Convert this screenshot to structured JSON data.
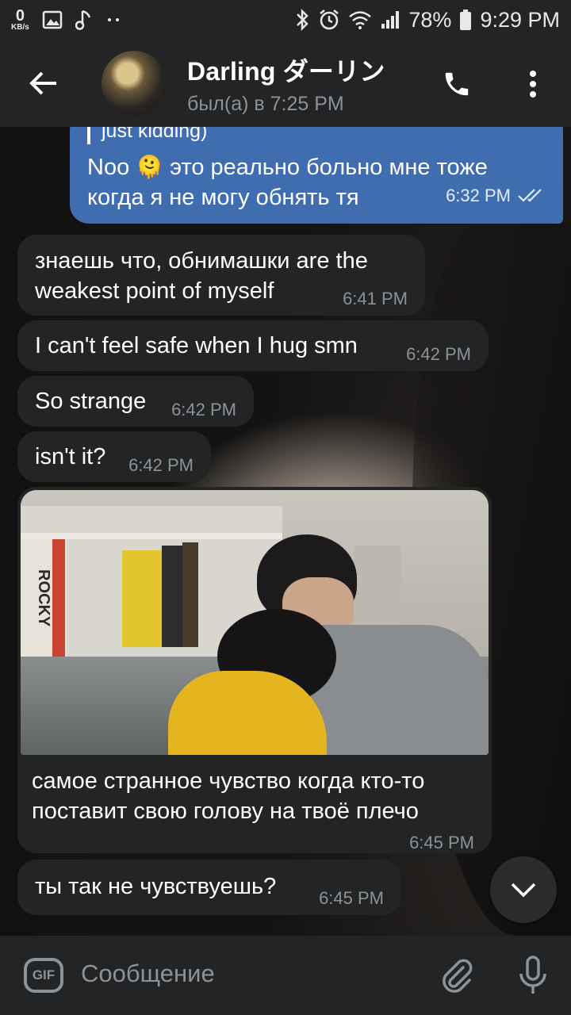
{
  "status_bar": {
    "net_speed": "0",
    "net_unit": "KB/s",
    "battery": "78%",
    "time": "9:29 PM"
  },
  "header": {
    "title": "Darling ダーリン",
    "subtitle": "был(а) в 7:25 PM"
  },
  "messages": [
    {
      "direction": "out",
      "reply_quote": "just kidding)",
      "text_before_emoji": "Noo",
      "emoji": "🫠",
      "text_after_emoji": "это реально больно мне тоже",
      "text_line2": "когда я не могу обнять тя",
      "time": "6:32 PM"
    },
    {
      "direction": "in",
      "line1": "знаешь что, обнимашки are the",
      "line2": "weakest point of myself",
      "time": "6:41 PM"
    },
    {
      "direction": "in",
      "text": "I can't feel safe when I hug smn",
      "time": "6:42 PM"
    },
    {
      "direction": "in",
      "text": "So strange",
      "time": "6:42 PM"
    },
    {
      "direction": "in",
      "text": "isn't it?",
      "time": "6:42 PM"
    },
    {
      "direction": "in",
      "photo_book_title": "ROCKY",
      "caption_line1": "самое странное чувство когда кто-то",
      "caption_line2": "поставит свою голову на твоё плечо",
      "time": "6:45 PM"
    },
    {
      "direction": "in",
      "text": "ты так не чувствуешь?",
      "time": "6:45 PM"
    }
  ],
  "input": {
    "gif_label": "GIF",
    "placeholder": "Сообщение"
  },
  "colors": {
    "bar": "#232425",
    "outgoing_bubble": "#3f6db0",
    "incoming_bubble": "#232425",
    "muted": "#8d9296"
  }
}
